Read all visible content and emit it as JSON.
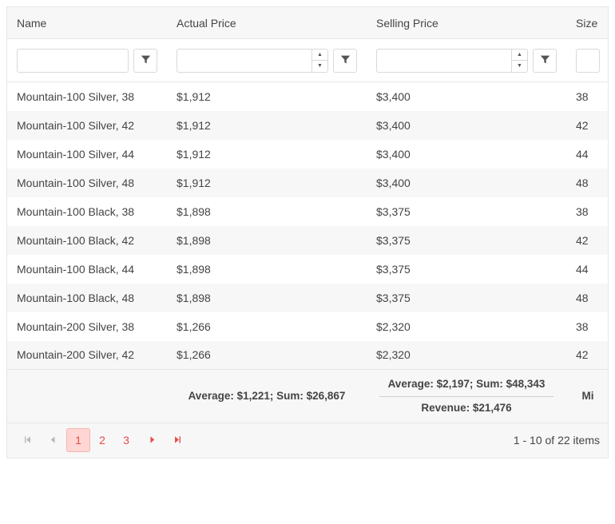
{
  "columns": {
    "name": "Name",
    "actual": "Actual Price",
    "selling": "Selling Price",
    "size": "Size"
  },
  "rows": [
    {
      "name": "Mountain-100 Silver, 38",
      "actual": "$1,912",
      "selling": "$3,400",
      "size": "38"
    },
    {
      "name": "Mountain-100 Silver, 42",
      "actual": "$1,912",
      "selling": "$3,400",
      "size": "42"
    },
    {
      "name": "Mountain-100 Silver, 44",
      "actual": "$1,912",
      "selling": "$3,400",
      "size": "44"
    },
    {
      "name": "Mountain-100 Silver, 48",
      "actual": "$1,912",
      "selling": "$3,400",
      "size": "48"
    },
    {
      "name": "Mountain-100 Black, 38",
      "actual": "$1,898",
      "selling": "$3,375",
      "size": "38"
    },
    {
      "name": "Mountain-100 Black, 42",
      "actual": "$1,898",
      "selling": "$3,375",
      "size": "42"
    },
    {
      "name": "Mountain-100 Black, 44",
      "actual": "$1,898",
      "selling": "$3,375",
      "size": "44"
    },
    {
      "name": "Mountain-100 Black, 48",
      "actual": "$1,898",
      "selling": "$3,375",
      "size": "48"
    },
    {
      "name": "Mountain-200 Silver, 38",
      "actual": "$1,266",
      "selling": "$2,320",
      "size": "38"
    },
    {
      "name": "Mountain-200 Silver, 42",
      "actual": "$1,266",
      "selling": "$2,320",
      "size": "42"
    }
  ],
  "aggregates": {
    "actual": "Average: $1,221; Sum: $26,867",
    "selling_line1": "Average: $2,197; Sum: $48,343",
    "selling_line2": "Revenue: $21,476",
    "size": "Mi"
  },
  "pager": {
    "pages": [
      "1",
      "2",
      "3"
    ],
    "active": 0,
    "info": "1 - 10 of 22 items"
  },
  "filters": {
    "name": "",
    "actual": "",
    "selling": "",
    "size": ""
  }
}
